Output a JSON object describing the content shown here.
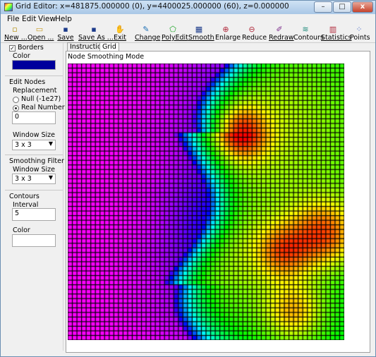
{
  "window": {
    "title": "Grid Editor: x=481875.000000 (0), y=4400025.000000 (60), z=0.000000",
    "minimize_label": "–",
    "maximize_label": "□",
    "close_label": "x"
  },
  "menu": [
    "File",
    "Edit",
    "View",
    "Help"
  ],
  "toolbar": [
    {
      "label": "New ...",
      "icon": "new-file-icon",
      "glyph": "▫"
    },
    {
      "label": "Open ...",
      "icon": "open-folder-icon",
      "glyph": "▭"
    },
    {
      "label": "Save",
      "icon": "save-disk-icon",
      "glyph": "▪"
    },
    {
      "label": "Save As ...",
      "icon": "save-as-disk-icon",
      "glyph": "▪"
    },
    {
      "label": "Exit",
      "icon": "exit-icon",
      "glyph": "✋"
    },
    {
      "label": "Change",
      "icon": "change-icon",
      "glyph": "✎"
    },
    {
      "label": "PolyEdit",
      "icon": "polygon-icon",
      "glyph": "⬠"
    },
    {
      "label": "Smooth",
      "icon": "smooth-icon",
      "glyph": "▦"
    },
    {
      "label": "Enlarge",
      "icon": "zoom-in-icon",
      "glyph": "⊕"
    },
    {
      "label": "Reduce",
      "icon": "zoom-out-icon",
      "glyph": "⊖"
    },
    {
      "label": "Redraw",
      "icon": "redraw-icon",
      "glyph": "✐"
    },
    {
      "label": "Contours",
      "icon": "contours-icon",
      "glyph": "≋"
    },
    {
      "label": "Statistics",
      "icon": "statistics-icon",
      "glyph": "▥"
    },
    {
      "label": "Points",
      "icon": "points-icon",
      "glyph": "⁘"
    }
  ],
  "panel": {
    "borders_label": "Borders",
    "borders_checked": true,
    "color_label": "Color",
    "border_color": "#00009c",
    "edit_nodes_label": "Edit Nodes",
    "replacement_label": "Replacement",
    "null_option": "Null (-1e27)",
    "real_option": "Real Number",
    "real_value": "0",
    "window_size_label": "Window Size",
    "window_size_value": "3 x 3",
    "smoothing_filter_label": "Smoothing Filter",
    "smoothing_window_label": "Window Size",
    "smoothing_window_value": "3 x 3",
    "contours_label": "Contours",
    "interval_label": "Interval",
    "interval_value": "5",
    "contour_color_label": "Color"
  },
  "tabs": [
    "Instructions",
    "Grid"
  ],
  "active_tab": "Grid",
  "main": {
    "mode_label": "Node Smoothing Mode"
  }
}
